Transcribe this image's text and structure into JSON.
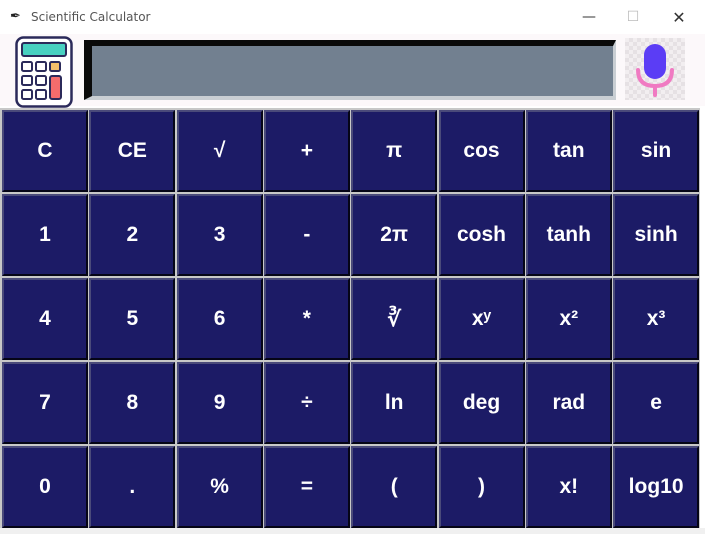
{
  "window": {
    "title": "Scientific Calculator",
    "app_icon": "feather-icon",
    "minimize": "—",
    "maximize": "☐",
    "close": "✕"
  },
  "display": {
    "value": ""
  },
  "header": {
    "calculator_icon": "calculator-icon",
    "mic_icon": "microphone-icon"
  },
  "colors": {
    "key_bg": "#1c1b66",
    "key_text": "#ffffff",
    "display_bg": "#728090",
    "mic": "#5b3df5"
  },
  "keys": [
    [
      "C",
      "CE",
      "√",
      "+",
      "π",
      "cos",
      "tan",
      "sin"
    ],
    [
      "1",
      "2",
      "3",
      "-",
      "2π",
      "cosh",
      "tanh",
      "sinh"
    ],
    [
      "4",
      "5",
      "6",
      "*",
      "∛",
      "xʸ",
      "x²",
      "x³"
    ],
    [
      "7",
      "8",
      "9",
      "÷",
      "ln",
      "deg",
      "rad",
      "e"
    ],
    [
      "0",
      ".",
      "%",
      "=",
      "(",
      ")",
      "x!",
      "log10"
    ]
  ]
}
